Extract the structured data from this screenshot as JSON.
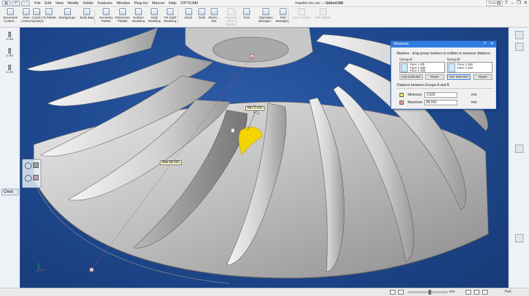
{
  "titlebar": {
    "quick_access": [
      "▤",
      "↶",
      "⋯"
    ],
    "menu": [
      "File",
      "Edit",
      "View",
      "Modify",
      "Solids",
      "Features",
      "Window",
      "Plug-Ins",
      "Macros",
      "Help",
      "OPTICAM"
    ],
    "window_title_file": "Impeller.vnc.vnc",
    "window_title_app": "GibbsCAM",
    "search_placeholder": "Search",
    "controls": [
      "?",
      "–",
      "❐",
      "✕"
    ]
  },
  "ribbon": {
    "buttons": [
      {
        "label1": "Document",
        "label2": "Control..."
      },
      {
        "label1": "View",
        "label2": "Control"
      },
      {
        "label1": "Coord.",
        "label2": "Systems"
      },
      {
        "label1": "CS Palette",
        "label2": ""
      },
      {
        "label1": "Workgroups",
        "label2": ""
      },
      {
        "label1": "Body Bag",
        "label2": ""
      },
      {
        "label1": "Geometry",
        "label2": "Palette"
      },
      {
        "label1": "Dimension",
        "label2": "Palette"
      },
      {
        "label1": "Surface",
        "label2": "Modeling"
      },
      {
        "label1": "Solid",
        "label2": "Modeling"
      },
      {
        "label1": "FS Solid",
        "label2": "Modeling"
      },
      {
        "label1": "Stock",
        "label2": ""
      },
      {
        "label1": "Tools",
        "label2": ""
      },
      {
        "label1": "Machi...",
        "label2": "Sim"
      },
      {
        "label1": "Process",
        "label2": "Error Checker"
      },
      {
        "label1": "Post",
        "label2": ""
      },
      {
        "label1": "Operation",
        "label2": "Manager..."
      },
      {
        "label1": "Part",
        "label2": "Manager..."
      },
      {
        "label1": "Sync Control",
        "label2": ""
      },
      {
        "label1": "Part Station",
        "label2": ""
      }
    ]
  },
  "left_tools": [
    {
      "label": "0.250"
    },
    {
      "label": "0.250"
    },
    {
      "label": "0.375"
    }
  ],
  "clear_label": "Clear",
  "measure": {
    "title": "Measure",
    "instructions": "Markers - drag group markers to entities to measure distance.",
    "group_a_label": "Group A",
    "group_a_items": "Face 1 2f0\nFace 1 3d6\nFace 1 4b8",
    "group_b_label": "Group B",
    "group_b_items": "Face 1 3b2\nFace 1 4e2",
    "use_selection_label": "Use Selection",
    "reset_label": "Reset",
    "distance_heading": "Distance between Groups A and B",
    "min_label": "Minimum",
    "min_value": "2.620",
    "max_label": "Maximum",
    "max_value": "86.561",
    "unit": "mm",
    "min_color": "#f3e86a",
    "max_color": "#f1a0a0"
  },
  "annotations": {
    "min_tag": "Min 2.620",
    "max_tag": "Max 86.561",
    "marker_a": "A",
    "marker_b": "B"
  },
  "status": {
    "unit": "mm",
    "part": "Part"
  },
  "colors": {
    "background": "#1f4a91",
    "accent": "#2f7de0",
    "highlight": "#f3d400"
  }
}
